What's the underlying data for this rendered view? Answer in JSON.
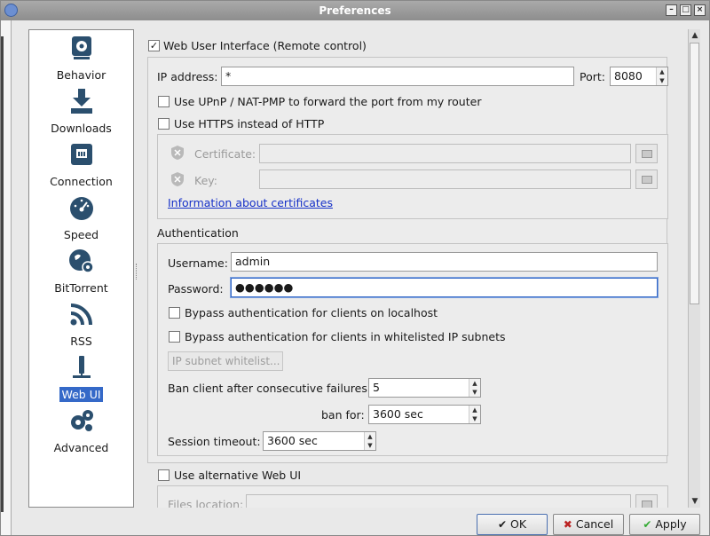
{
  "window": {
    "title": "Preferences"
  },
  "sidebar": {
    "items": [
      {
        "label": "Behavior",
        "icon": "gear-icon"
      },
      {
        "label": "Downloads",
        "icon": "download-icon"
      },
      {
        "label": "Connection",
        "icon": "network-icon"
      },
      {
        "label": "Speed",
        "icon": "speedometer-icon"
      },
      {
        "label": "BitTorrent",
        "icon": "bittorrent-globe-icon"
      },
      {
        "label": "RSS",
        "icon": "rss-icon"
      },
      {
        "label": "Web UI",
        "icon": "web-ui-icon"
      },
      {
        "label": "Advanced",
        "icon": "gears-icon"
      }
    ],
    "selected": "Web UI"
  },
  "webui": {
    "enable_label": "Web User Interface (Remote control)",
    "ip_label": "IP address:",
    "ip_value": "*",
    "port_label": "Port:",
    "port_value": "8080",
    "upnp_label": "Use UPnP / NAT-PMP to forward the port from my router",
    "https_label": "Use HTTPS instead of HTTP",
    "cert_label": "Certificate:",
    "key_label": "Key:",
    "cert_info_link": "Information about certificates",
    "auth_title": "Authentication",
    "username_label": "Username:",
    "username_value": "admin",
    "password_label": "Password:",
    "password_value": "●●●●●●",
    "bypass_localhost_label": "Bypass authentication for clients on localhost",
    "bypass_whitelist_label": "Bypass authentication for clients in whitelisted IP subnets",
    "subnet_button": "IP subnet whitelist...",
    "ban_label": "Ban client after consecutive failures:",
    "ban_value": "5",
    "ban_for_label": "ban for:",
    "ban_for_value": "3600 sec",
    "session_label": "Session timeout:",
    "session_value": "3600 sec",
    "alt_webui_label": "Use alternative Web UI",
    "files_location_label": "Files location:"
  },
  "buttons": {
    "ok": "OK",
    "cancel": "Cancel",
    "apply": "Apply"
  },
  "colors": {
    "selection": "#3569c8",
    "link": "#1530c8"
  }
}
